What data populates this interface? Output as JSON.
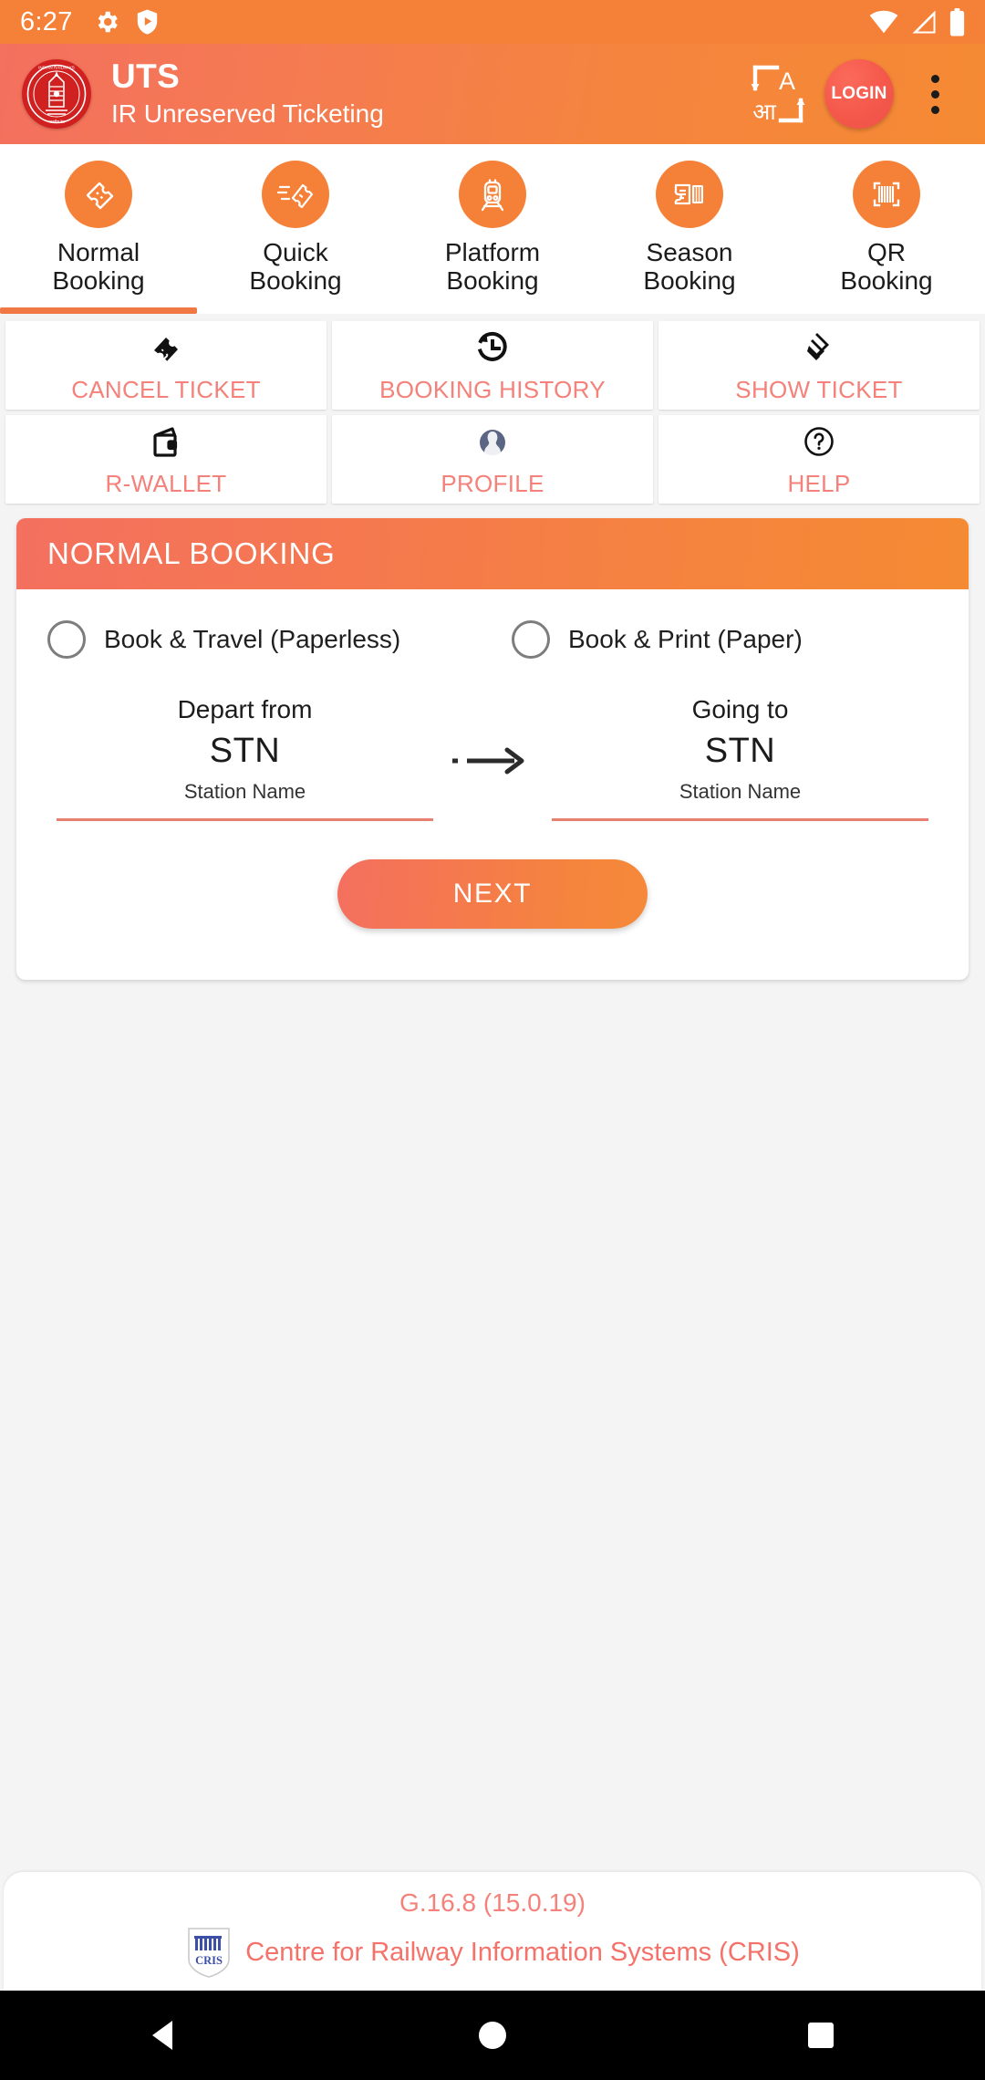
{
  "status_bar": {
    "time": "6:27",
    "left_icons": [
      "settings-gear-icon",
      "play-protect-icon"
    ],
    "right_icons": [
      "wifi-icon",
      "cellular-signal-icon",
      "battery-icon"
    ]
  },
  "app_bar": {
    "logo": "indian-railways-logo",
    "title": "UTS",
    "subtitle": "IR Unreserved Ticketing",
    "language_toggle": "language-translate-icon",
    "login_label": "LOGIN",
    "overflow": "more-options-icon"
  },
  "tabs": [
    {
      "label_line1": "Normal",
      "label_line2": "Booking",
      "icon": "ticket-icon",
      "active": true
    },
    {
      "label_line1": "Quick",
      "label_line2": "Booking",
      "icon": "fast-ticket-icon",
      "active": false
    },
    {
      "label_line1": "Platform",
      "label_line2": "Booking",
      "icon": "train-icon",
      "active": false
    },
    {
      "label_line1": "Season",
      "label_line2": "Booking",
      "icon": "season-pass-icon",
      "active": false
    },
    {
      "label_line1": "QR",
      "label_line2": "Booking",
      "icon": "qr-barcode-icon",
      "active": false
    }
  ],
  "quick_actions": [
    {
      "label": "CANCEL TICKET",
      "icon": "cancel-ticket-icon"
    },
    {
      "label": "BOOKING HISTORY",
      "icon": "history-clock-icon"
    },
    {
      "label": "SHOW TICKET",
      "icon": "show-ticket-icon"
    },
    {
      "label": "R-WALLET",
      "icon": "wallet-icon"
    },
    {
      "label": "PROFILE",
      "icon": "person-icon"
    },
    {
      "label": "HELP",
      "icon": "question-mark-icon"
    }
  ],
  "booking_card": {
    "header": "NORMAL BOOKING",
    "options": [
      {
        "label": "Book & Travel (Paperless)",
        "selected": false
      },
      {
        "label": "Book & Print (Paper)",
        "selected": false
      }
    ],
    "from": {
      "caption": "Depart from",
      "code": "STN",
      "hint": "Station Name"
    },
    "to": {
      "caption": "Going to",
      "code": "STN",
      "hint": "Station Name"
    },
    "arrow_icon": "arrow-right-icon",
    "next_label": "NEXT"
  },
  "footer": {
    "version": "G.16.8 (15.0.19)",
    "org": "Centre for Railway Information Systems (CRIS)",
    "logo": "cris-logo"
  },
  "nav_bar": {
    "back": "back-triangle-icon",
    "home": "home-circle-icon",
    "recents": "recents-square-icon"
  },
  "colors": {
    "accent_orange": "#f58138",
    "header_gradient_start": "#f4705f",
    "header_gradient_end": "#f58a33",
    "salmon_text": "#f4817a",
    "railway_red": "#d0201f"
  }
}
